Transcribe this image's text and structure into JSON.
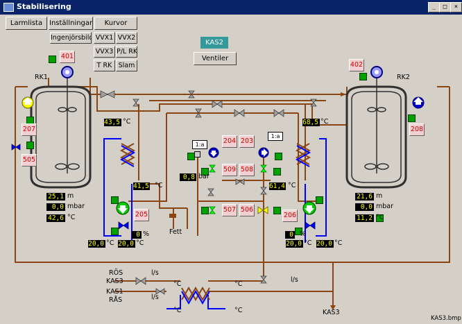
{
  "window": {
    "title": "Stabilisering",
    "min": "_",
    "max": "□",
    "close": "×"
  },
  "toolbar": {
    "larmlista": "Larmlista",
    "installningar": "Inställningar",
    "kurvor": "Kurvor",
    "ingenjorsbild": "Ingenjörsbild",
    "vvx1": "VVX1",
    "vvx2": "VVX2",
    "vvx3": "VVX3",
    "plrk": "P/L RK",
    "trk": "T RK",
    "slam": "Slam"
  },
  "header": {
    "kas2": "KAS2",
    "ventiler": "Ventiler"
  },
  "tanks": {
    "rk1": "RK1",
    "rk2": "RK2"
  },
  "valves": {
    "v401": "401",
    "v402": "402",
    "v207": "207",
    "v208": "208",
    "v505": "505",
    "v205": "205",
    "v204": "204",
    "v203": "203",
    "v509": "509",
    "v508": "508",
    "v507": "507",
    "v506": "506",
    "v206": "206"
  },
  "readouts": {
    "t_rk1_hx": "43,5",
    "t_rk2_hx": "68,5",
    "t_ret1": "41,5",
    "p_bar": "0,8",
    "t_ret2": "61,4",
    "rk1_level": "25,1",
    "rk1_press": "0,0",
    "rk1_temp": "42,6",
    "rk2_level": "21,6",
    "rk2_press": "0,0",
    "rk2_temp": "11,2",
    "pct_left": "0",
    "pct_right": "0",
    "t_sup_l1": "20,0",
    "t_sup_l2": "20,0",
    "t_sup_r1": "20,0",
    "t_sup_r2": "20,0"
  },
  "units": {
    "c": "°C",
    "m": "m",
    "mbar": "mbar",
    "bar": "bar",
    "pct": "%",
    "ls": "l/s"
  },
  "labels": {
    "one_a_left": "1:a",
    "one_a_right": "1:a",
    "fett": "Fett",
    "ros": "RÖS",
    "kas3_in": "KAS3",
    "kas1": "KAS1",
    "ras": "RÅS",
    "kas3_out": "KAS3",
    "file": "KAS3.bmp"
  },
  "colors": {
    "pipe_brown": "#8b4513",
    "pipe_blue": "#0000ff",
    "valve_red": "#cc0000",
    "status_green": "#00a000",
    "title_bar": "#0a246a",
    "kas2_teal": "#339999"
  }
}
